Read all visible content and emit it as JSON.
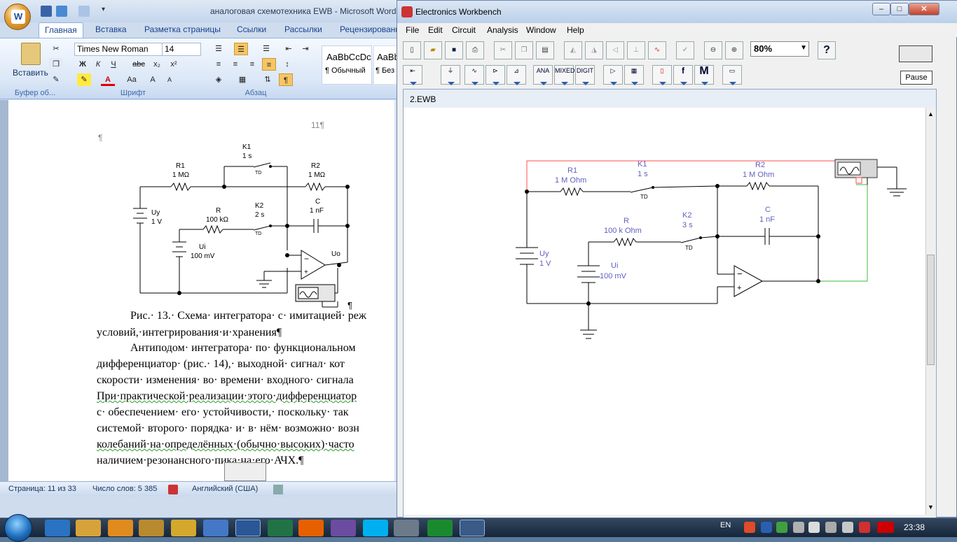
{
  "word": {
    "title": "аналоговая схемотехника EWB - Microsoft Word",
    "orb_label": "W",
    "tabs": [
      "Главная",
      "Вставка",
      "Разметка страницы",
      "Ссылки",
      "Рассылки",
      "Рецензирование"
    ],
    "font_name": "Times New Roman",
    "font_size": "14",
    "paste_label": "Вставить",
    "groups": {
      "clipboard": "Буфер об...",
      "font": "Шрифт",
      "paragraph": "Абзац"
    },
    "styles": [
      {
        "sample": "AaBbCcDc",
        "name": "¶ Обычный"
      },
      {
        "sample": "AaBbC",
        "name": "¶ Без"
      }
    ],
    "page_number": "11¶",
    "pilcrow": "¶",
    "figure": {
      "k1": "K1",
      "k1_t": "1 s",
      "r1": "R1",
      "r1_v": "1 MΩ",
      "r2": "R2",
      "r2_v": "1 MΩ",
      "r": "R",
      "r_v": "100 kΩ",
      "k2": "K2",
      "k2_t": "2 s",
      "c": "C",
      "c_v": "1 nF",
      "uy": "Uy",
      "uy_v": "1 V",
      "ui": "Ui",
      "ui_v": "100 mV",
      "uo": "Uo",
      "td": "TD",
      "pilcrow": "¶"
    },
    "paragraphs": [
      "Рис.· 13.· Схема· интегратора· с· имитацией· реж",
      "условий,·интегрирования·и·хранения¶",
      "Антиподом· интегратора· по· функциональном",
      "дифференциатор· (рис.· 14),· выходной· сигнал· кот",
      "скорости· изменения· во· времени· входного· сигнала",
      "При·практической·реализации·этого·дифференциатор",
      "с·  обеспечением·  его·  устойчивости,·  поскольку·  так",
      "системой· второго· порядка· и· в· нём· возможно· возн",
      "колебаний·на·определённых·(обычно·высоких)·часто",
      "наличием·резонансного·пика·на·его·АЧХ.¶"
    ],
    "status": {
      "page": "Страница: 11 из 33",
      "words": "Число слов: 5 385",
      "lang": "Английский (США)"
    }
  },
  "ewb": {
    "title": "Electronics Workbench",
    "menu": [
      "File",
      "Edit",
      "Circuit",
      "Analysis",
      "Window",
      "Help"
    ],
    "zoom": "80%",
    "help": "?",
    "pause": "Pause",
    "tb_parts": [
      "ANA",
      "MIXED",
      "DIGIT"
    ],
    "tb_m": "M",
    "tb_f": "f",
    "doc_title": "2.EWB",
    "circuit": {
      "r1": "R1",
      "r1_v": "1 M Ohm",
      "k1": "K1",
      "k1_t": "1 s",
      "r2": "R2",
      "r2_v": "1 M Ohm",
      "r": "R",
      "r_v": "100 k Ohm",
      "k2": "K2",
      "k2_t": "3 s",
      "c": "C",
      "c_v": "1 nF",
      "uy": "Uy",
      "uy_v": "1 V",
      "ui": "Ui",
      "ui_v": "100 mV",
      "td": "TD"
    }
  },
  "taskbar": {
    "lang": "EN",
    "time": "23:38"
  }
}
